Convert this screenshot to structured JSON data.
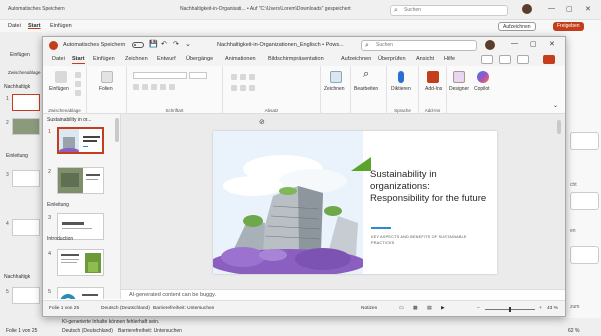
{
  "background_window": {
    "autosave": "Automatisches Speichern",
    "title": "Nachhaltigkeit-in-Organisati... • Auf \"C:\\Users\\Lorem\\Downloads\" gespeichert",
    "search": "Suchen",
    "menu": [
      "Datei",
      "Start",
      "Einfügen",
      "Zeichnen",
      "Entwurf",
      "Übergänge",
      "Animationen",
      "Bildschirmpräsentation",
      "Aufzeichnen",
      "Überprüfen",
      "Ansicht",
      "Hilfe"
    ],
    "record_button": "Aufzeichnen",
    "share_button": "Freigeben",
    "left_labels": [
      "Einfügen",
      "Zwischenablage"
    ],
    "sections": [
      "Nachhaltigk",
      "Einleitung",
      "Nachhaltigk"
    ],
    "slide_numbers": [
      "1",
      "2",
      "3",
      "4",
      "5"
    ],
    "right_panel_text": [
      "cht",
      "en",
      "zum"
    ],
    "status_left": "Folie 1 von 25",
    "status_lang": "Deutsch (Deutschland)",
    "status_access": "Barrierefreiheit: Untersuchen",
    "status_notes": "KI-generierte Inhalte können fehlerhaft sein.",
    "status_zoom": "62 %"
  },
  "window": {
    "autosave": "Automatisches Speichern",
    "title": "Nachhaltigkeit-in-Organizationen_Englisch • Pows...",
    "search": "Suchen",
    "controls": [
      "—",
      "▢",
      "✕"
    ]
  },
  "menu": {
    "items": [
      "Datei",
      "Start",
      "Einfügen",
      "Zeichnen",
      "Entwurf",
      "Übergänge",
      "Animationen",
      "Bildschirmpräsentation",
      "Aufzeichnen",
      "Überprüfen",
      "Ansicht",
      "Hilfe"
    ],
    "active": "Start"
  },
  "ribbon": {
    "paste": "Einfügen",
    "clipboard": "Zwischenablage",
    "slides": "Folien",
    "font": "Schriftart",
    "paragraph": "Absatz",
    "drawing": "Zeichnen",
    "editing": "Bearbeiten",
    "dictate": "Diktieren",
    "voice": "Sprache",
    "addins": "Add-Ins",
    "addins_group": "Add-Ins",
    "designer": "Designer",
    "copilot": "Copilot"
  },
  "thumbnails": {
    "sections": [
      "Sustainability in or...",
      "Einleitung",
      "Introduction"
    ],
    "numbers": [
      "1",
      "2",
      "3",
      "4",
      "5"
    ]
  },
  "slide": {
    "title": "Sustainability in organizations: Responsibility for the future",
    "subtitle": "KEY ASPECTS AND BENEFITS OF SUSTAINABLE PRACTICES"
  },
  "notes": "AI-generated content can be buggy.",
  "status": {
    "slide_count": "Folie 1 von 25",
    "language": "Deutsch (Deutschland)",
    "accessibility": "Barrierefreiheit: Untersuchen",
    "notes": "Notizen",
    "zoom": "43 %",
    "zoom_fraction": 0.43
  },
  "colors": {
    "accent": "#c43e1c",
    "slide_line": "#2b8bd0",
    "flowers": "#8a5fc0",
    "leaf": "#5ba32b"
  }
}
